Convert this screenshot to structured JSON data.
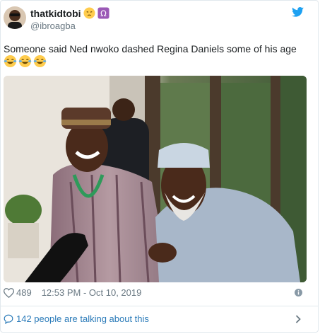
{
  "user": {
    "display_name": "thatkidtobi",
    "handle": "@ibroagba",
    "badges": [
      "pensive-face-emoji",
      "omega-sign-emoji"
    ]
  },
  "tweet": {
    "text": "Someone said Ned nwoko dashed Regina Daniels some of his age",
    "emojis": [
      "face-with-tears-of-joy",
      "face-with-tears-of-joy",
      "face-with-tears-of-joy"
    ]
  },
  "meta": {
    "like_count": "489",
    "timestamp": "12:53 PM - Oct 10, 2019"
  },
  "conversation": {
    "label": "142 people are talking about this"
  },
  "colors": {
    "link": "#2b7bb9",
    "muted": "#697882",
    "twitter_blue": "#1da1f2",
    "omega_purple": "#9b59b6"
  }
}
